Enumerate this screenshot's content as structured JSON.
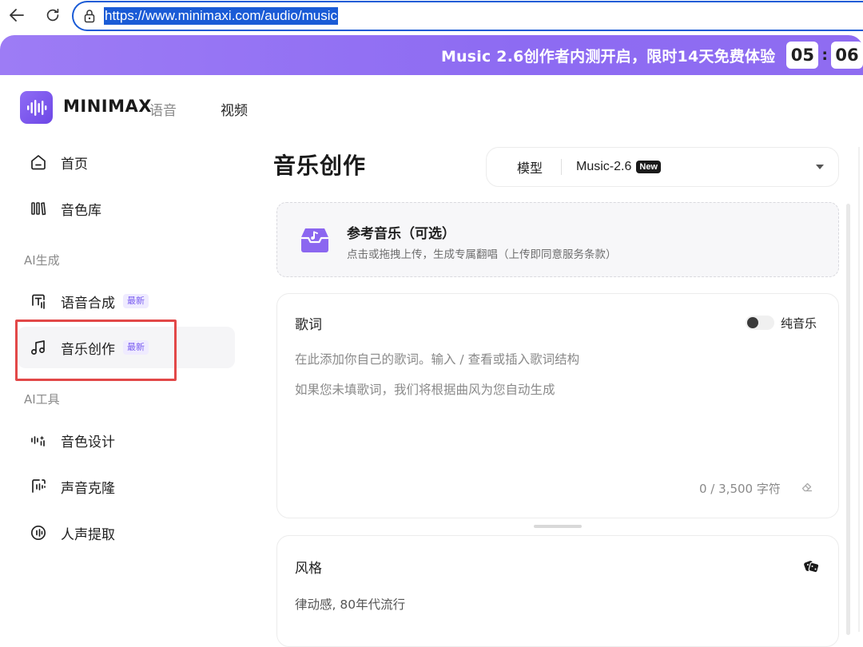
{
  "browser": {
    "url": "https://www.minimaxi.com/audio/music"
  },
  "banner": {
    "text": "Music 2.6创作者内测开启，限时14天免费体验",
    "countdown_hours": "05",
    "countdown_minutes": "06"
  },
  "header": {
    "brand": "MINIMAX",
    "brand_sub": "语音",
    "nav_video": "视频"
  },
  "sidebar": {
    "items_top": [
      {
        "label": "首页",
        "icon": "home-icon"
      },
      {
        "label": "音色库",
        "icon": "voice-library-icon"
      }
    ],
    "group_ai_gen": "AI生成",
    "items_gen": [
      {
        "label": "语音合成",
        "badge": "最新",
        "icon": "text-to-speech-icon"
      },
      {
        "label": "音乐创作",
        "badge": "最新",
        "icon": "music-note-icon"
      }
    ],
    "group_ai_tools": "AI工具",
    "items_tools": [
      {
        "label": "音色设计",
        "icon": "voice-design-icon"
      },
      {
        "label": "声音克隆",
        "icon": "voice-clone-icon"
      },
      {
        "label": "人声提取",
        "icon": "vocal-extract-icon"
      }
    ]
  },
  "main": {
    "title": "音乐创作",
    "model_label": "模型",
    "model_value": "Music-2.6",
    "model_badge": "New",
    "upload": {
      "title": "参考音乐（可选）",
      "desc": "点击或拖拽上传，生成专属翻唱（上传即同意服务条款）"
    },
    "lyrics": {
      "title": "歌词",
      "pure_music": "纯音乐",
      "placeholder_1": "在此添加你自己的歌词。输入 / 查看或插入歌词结构",
      "placeholder_2": "如果您未填歌词，我们将根据曲风为您自动生成",
      "char_count": "0 / 3,500 字符"
    },
    "style": {
      "title": "风格",
      "value": "律动感, 80年代流行"
    }
  },
  "colors": {
    "accent": "#7a5df0",
    "url_highlight": "#1a5bd6",
    "annotation_red": "#e24848"
  }
}
